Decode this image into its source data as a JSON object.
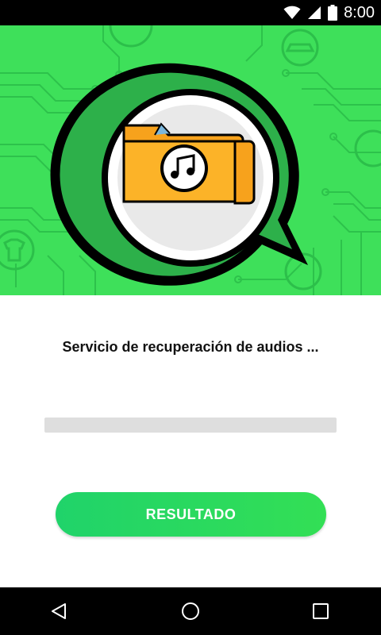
{
  "status_bar": {
    "time": "8:00",
    "icons": [
      "wifi-icon",
      "signal-icon",
      "battery-icon"
    ]
  },
  "hero": {
    "background_color": "#3ee05a",
    "image": "folder-music-chat-bubble"
  },
  "main": {
    "loading_text": "Servicio de recuperación de audios ...",
    "progress": 0,
    "result_button_label": "RESULTADO"
  },
  "colors": {
    "accent": "#25d366",
    "button_gradient_start": "#20d36a",
    "button_gradient_end": "#33df55",
    "progress_track": "#dedede"
  },
  "nav_bar": {
    "icons": [
      "back-icon",
      "home-icon",
      "recents-icon"
    ]
  }
}
